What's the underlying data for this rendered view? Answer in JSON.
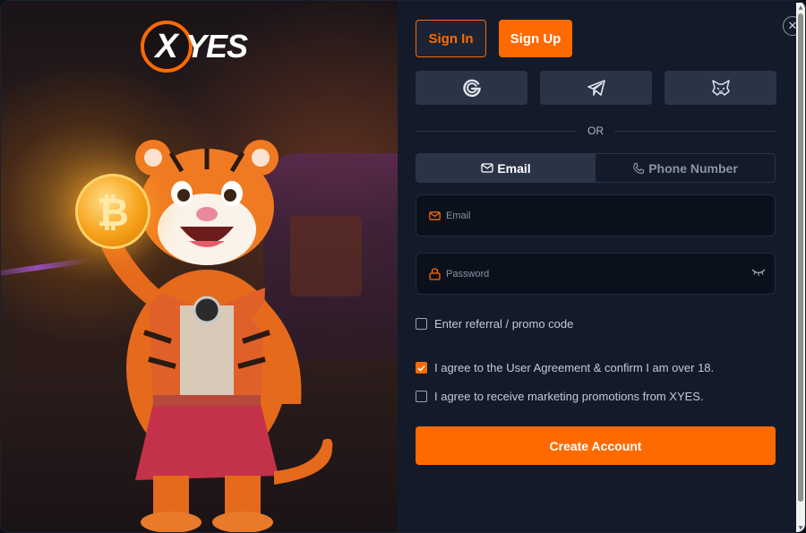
{
  "brand": {
    "logo_x": "X",
    "logo_rest": "YES",
    "accent": "#ff6a00"
  },
  "auth_tabs": {
    "sign_in": "Sign In",
    "sign_up": "Sign Up"
  },
  "close_icon": "close-icon",
  "social": {
    "icons": [
      "google-icon",
      "telegram-icon",
      "metamask-icon"
    ]
  },
  "or_text": "OR",
  "method_switch": {
    "email": "Email",
    "phone": "Phone Number"
  },
  "fields": {
    "email_placeholder": "Email",
    "password_placeholder": "Password"
  },
  "checkboxes": {
    "referral": {
      "label": "Enter referral / promo code",
      "checked": false
    },
    "agreement": {
      "label": "I agree to the User Agreement & confirm I am over 18.",
      "checked": true
    },
    "marketing": {
      "label": "I agree to receive marketing promotions from XYES.",
      "checked": false
    }
  },
  "create_button": "Create Account"
}
